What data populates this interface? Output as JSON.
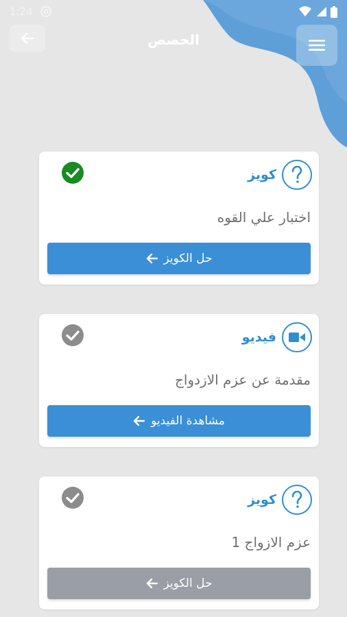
{
  "status_bar": {
    "time": "1:24",
    "icons": [
      "at-sign-icon",
      "wifi-icon",
      "signal-icon",
      "battery-icon"
    ]
  },
  "header": {
    "title": "الحصص",
    "back_icon": "arrow-left-icon",
    "menu_icon": "menu-icon"
  },
  "lessons": [
    {
      "type_label": "كويز",
      "type_icon": "question-icon",
      "title": "اختبار علي القوه",
      "action_label": "حل الكويز",
      "completed": true,
      "button_enabled": true
    },
    {
      "type_label": "فيديو",
      "type_icon": "video-icon",
      "title": "مقدمة عن عزم الازدواج",
      "action_label": "مشاهدة الفيديو",
      "completed": false,
      "button_enabled": true
    },
    {
      "type_label": "كويز",
      "type_icon": "question-icon",
      "title": "عزم الازواج 1",
      "action_label": "حل الكويز",
      "completed": false,
      "button_enabled": false
    }
  ],
  "colors": {
    "accent": "#2f8ed2",
    "button_active": "#3a8fd6",
    "button_disabled": "#9a9ea6",
    "completed": "#1a8a22",
    "not_completed": "#8c8c8c",
    "background": "#e6e6e6"
  }
}
